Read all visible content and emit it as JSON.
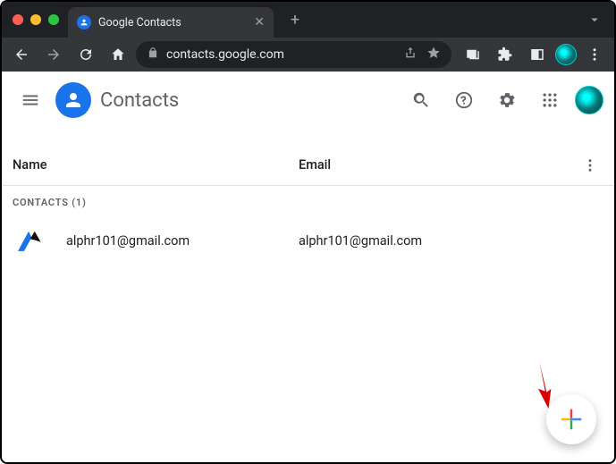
{
  "browser": {
    "tab_title": "Google Contacts",
    "url": "contacts.google.com"
  },
  "header": {
    "app_title": "Contacts"
  },
  "columns": {
    "name": "Name",
    "email": "Email"
  },
  "section": {
    "label": "CONTACTS (1)"
  },
  "contacts": [
    {
      "name": "alphr101@gmail.com",
      "email": "alphr101@gmail.com"
    }
  ]
}
